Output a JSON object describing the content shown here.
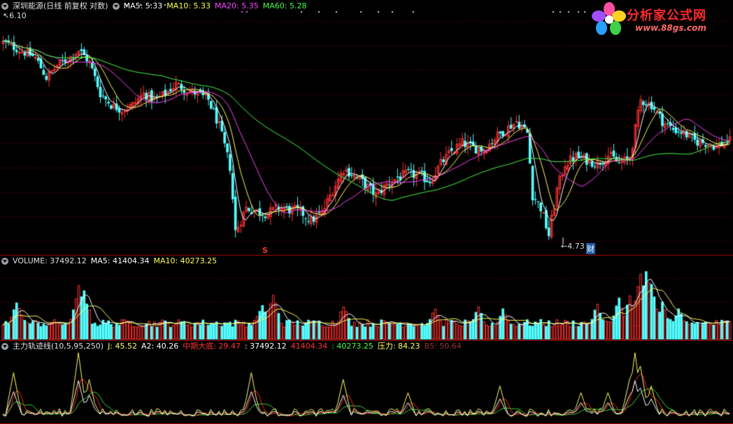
{
  "price_panel": {
    "title": "深圳能源(日线 前复权 对数)",
    "indicators": [
      {
        "label": "MA5: 5.33",
        "color": "#ffffff"
      },
      {
        "label": "MA10: 5.33",
        "color": "#ffff55"
      },
      {
        "label": "MA20: 5.35",
        "color": "#ff44ff"
      },
      {
        "label": "MA60: 5.28",
        "color": "#44ff44"
      }
    ],
    "high_label": "6.10",
    "low_label": "4.73",
    "marker_s": "S",
    "marker_cai": "财"
  },
  "volume_panel": {
    "title": "VOLUME: 37492.12",
    "indicators": [
      {
        "label": "MA5: 41404.34",
        "color": "#ffffff"
      },
      {
        "label": "MA10: 40273.25",
        "color": "#ffff55"
      }
    ]
  },
  "osc_panel": {
    "title": "主力轨迹线(10,5,95,250)",
    "indicators": [
      {
        "label": "J: 45.52",
        "color": "#ffff55"
      },
      {
        "label": "A2: 40.26",
        "color": "#ffffff"
      },
      {
        "label": "中期大底: 29.47",
        "color": "#ff3333"
      },
      {
        "label": ": 37492.12",
        "color": "#ffffff"
      },
      {
        "label": "41404.34",
        "color": "#ff3333"
      },
      {
        "label": ": 40273.25",
        "color": "#44ff44"
      },
      {
        "label": "压力: 84.23",
        "color": "#ffff55"
      },
      {
        "label": "B5: 50.64",
        "color": "#993333"
      }
    ]
  },
  "logo": {
    "brand": "分析家公式网",
    "url": "www.88gs.com"
  },
  "colors": {
    "up": "#ff3333",
    "down": "#54ffff",
    "grid": "#8b0000",
    "ma5": "#ffffff",
    "ma10": "#ffff55",
    "ma20": "#ff44ff",
    "ma60": "#44ff44"
  },
  "chart_data": {
    "type": "candlestick",
    "anchors_close": [
      [
        0,
        5.95
      ],
      [
        6,
        5.9
      ],
      [
        12,
        5.85
      ],
      [
        16,
        5.72
      ],
      [
        20,
        5.8
      ],
      [
        24,
        5.84
      ],
      [
        28,
        5.9
      ],
      [
        32,
        5.82
      ],
      [
        36,
        5.62
      ],
      [
        40,
        5.55
      ],
      [
        44,
        5.52
      ],
      [
        48,
        5.55
      ],
      [
        52,
        5.62
      ],
      [
        56,
        5.58
      ],
      [
        60,
        5.62
      ],
      [
        64,
        5.68
      ],
      [
        68,
        5.64
      ],
      [
        72,
        5.62
      ],
      [
        76,
        5.58
      ],
      [
        80,
        5.42
      ],
      [
        84,
        5.18
      ],
      [
        86,
        4.82
      ],
      [
        90,
        4.95
      ],
      [
        94,
        4.93
      ],
      [
        98,
        4.92
      ],
      [
        102,
        4.95
      ],
      [
        106,
        4.94
      ],
      [
        110,
        4.93
      ],
      [
        114,
        4.88
      ],
      [
        118,
        4.92
      ],
      [
        122,
        5.05
      ],
      [
        126,
        5.17
      ],
      [
        130,
        5.13
      ],
      [
        134,
        5.08
      ],
      [
        138,
        5.02
      ],
      [
        142,
        5.08
      ],
      [
        146,
        5.12
      ],
      [
        150,
        5.14
      ],
      [
        154,
        5.13
      ],
      [
        158,
        5.1
      ],
      [
        162,
        5.2
      ],
      [
        166,
        5.27
      ],
      [
        170,
        5.32
      ],
      [
        174,
        5.29
      ],
      [
        178,
        5.28
      ],
      [
        182,
        5.35
      ],
      [
        186,
        5.4
      ],
      [
        190,
        5.45
      ],
      [
        194,
        5.38
      ],
      [
        196,
        5.02
      ],
      [
        199,
        4.95
      ],
      [
        202,
        4.8
      ],
      [
        205,
        5.05
      ],
      [
        208,
        5.2
      ],
      [
        212,
        5.24
      ],
      [
        216,
        5.22
      ],
      [
        220,
        5.2
      ],
      [
        224,
        5.25
      ],
      [
        228,
        5.2
      ],
      [
        232,
        5.23
      ],
      [
        236,
        5.58
      ],
      [
        240,
        5.55
      ],
      [
        244,
        5.45
      ],
      [
        248,
        5.4
      ],
      [
        252,
        5.38
      ],
      [
        256,
        5.33
      ],
      [
        260,
        5.32
      ],
      [
        264,
        5.3
      ],
      [
        268,
        5.33
      ]
    ],
    "volume_spikes": [
      [
        5,
        1.6
      ],
      [
        28,
        2.2
      ],
      [
        30,
        2.0
      ],
      [
        96,
        1.5
      ],
      [
        100,
        1.9
      ],
      [
        126,
        1.4
      ],
      [
        160,
        1.3
      ],
      [
        176,
        1.3
      ],
      [
        185,
        1.3
      ],
      [
        220,
        1.5
      ],
      [
        228,
        1.7
      ],
      [
        232,
        1.8
      ],
      [
        236,
        2.8
      ],
      [
        238,
        3.0
      ],
      [
        240,
        2.3
      ],
      [
        244,
        1.5
      ],
      [
        250,
        1.2
      ]
    ],
    "osc_spikes": [
      [
        4,
        0.7
      ],
      [
        28,
        1.0
      ],
      [
        32,
        0.6
      ],
      [
        92,
        0.7
      ],
      [
        126,
        0.6
      ],
      [
        150,
        0.4
      ],
      [
        184,
        0.5
      ],
      [
        214,
        0.4
      ],
      [
        224,
        0.4
      ],
      [
        232,
        0.6
      ],
      [
        234,
        1.0
      ],
      [
        236,
        0.8
      ],
      [
        240,
        0.5
      ]
    ],
    "ylim_price": [
      4.7,
      6.15
    ],
    "bar_count": 270
  }
}
